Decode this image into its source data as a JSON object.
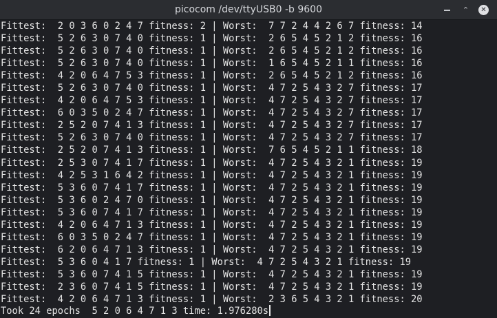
{
  "window": {
    "title": "picocom /dev/ttyUSB0 -b 9600",
    "buttons": {
      "minimize_icon": "minimize-icon",
      "restore_icon": "restore-icon",
      "close_icon": "close-icon",
      "restore_glyph": "⌃",
      "close_glyph": "✕"
    }
  },
  "terminal": {
    "lines": [
      "Fittest:  2 0 3 6 0 2 4 7 fitness: 2 | Worst:  7 7 2 4 4 2 6 7 fitness: 14",
      "Fittest:  5 2 6 3 0 7 4 0 fitness: 1 | Worst:  2 6 5 4 5 2 1 2 fitness: 16",
      "Fittest:  5 2 6 3 0 7 4 0 fitness: 1 | Worst:  2 6 5 4 5 2 1 2 fitness: 16",
      "Fittest:  5 2 6 3 0 7 4 0 fitness: 1 | Worst:  1 6 5 4 5 2 1 1 fitness: 16",
      "Fittest:  4 2 0 6 4 7 5 3 fitness: 1 | Worst:  2 6 5 4 5 2 1 2 fitness: 16",
      "Fittest:  5 2 6 3 0 7 4 0 fitness: 1 | Worst:  4 7 2 5 4 3 2 7 fitness: 17",
      "Fittest:  4 2 0 6 4 7 5 3 fitness: 1 | Worst:  4 7 2 5 4 3 2 7 fitness: 17",
      "Fittest:  6 0 3 5 0 2 4 7 fitness: 1 | Worst:  4 7 2 5 4 3 2 7 fitness: 17",
      "Fittest:  2 5 2 0 7 4 1 3 fitness: 1 | Worst:  4 7 2 5 4 3 2 7 fitness: 17",
      "Fittest:  5 2 6 3 0 7 4 0 fitness: 1 | Worst:  4 7 2 5 4 3 2 7 fitness: 17",
      "Fittest:  2 5 2 0 7 4 1 3 fitness: 1 | Worst:  7 6 5 4 5 2 1 1 fitness: 18",
      "Fittest:  2 5 3 0 7 4 1 7 fitness: 1 | Worst:  4 7 2 5 4 3 2 1 fitness: 19",
      "Fittest:  4 2 5 3 1 6 4 2 fitness: 1 | Worst:  4 7 2 5 4 3 2 1 fitness: 19",
      "Fittest:  5 3 6 0 7 4 1 7 fitness: 1 | Worst:  4 7 2 5 4 3 2 1 fitness: 19",
      "Fittest:  5 3 6 0 2 4 7 0 fitness: 1 | Worst:  4 7 2 5 4 3 2 1 fitness: 19",
      "Fittest:  5 3 6 0 7 4 1 7 fitness: 1 | Worst:  4 7 2 5 4 3 2 1 fitness: 19",
      "Fittest:  4 2 0 6 4 7 1 3 fitness: 1 | Worst:  4 7 2 5 4 3 2 1 fitness: 19",
      "Fittest:  6 0 3 5 0 2 4 7 fitness: 1 | Worst:  4 7 2 5 4 3 2 1 fitness: 19",
      "Fittest:  6 2 0 6 4 7 1 3 fitness: 1 | Worst:  4 7 2 5 4 3 2 1 fitness: 19",
      "Fittest:  5 3 6 0 4 1 7 fitness: 1 | Worst:  4 7 2 5 4 3 2 1 fitness: 19",
      "Fittest:  5 3 6 0 7 4 1 5 fitness: 1 | Worst:  4 7 2 5 4 3 2 1 fitness: 19",
      "Fittest:  2 3 6 0 7 4 1 5 fitness: 1 | Worst:  4 7 2 5 4 3 2 1 fitness: 19",
      "Fittest:  4 2 0 6 4 7 1 3 fitness: 1 | Worst:  2 3 6 5 4 3 2 1 fitness: 20"
    ],
    "final_line": "Took 24 epochs  5 2 0 6 4 7 1 3 time: 1.976280s"
  }
}
